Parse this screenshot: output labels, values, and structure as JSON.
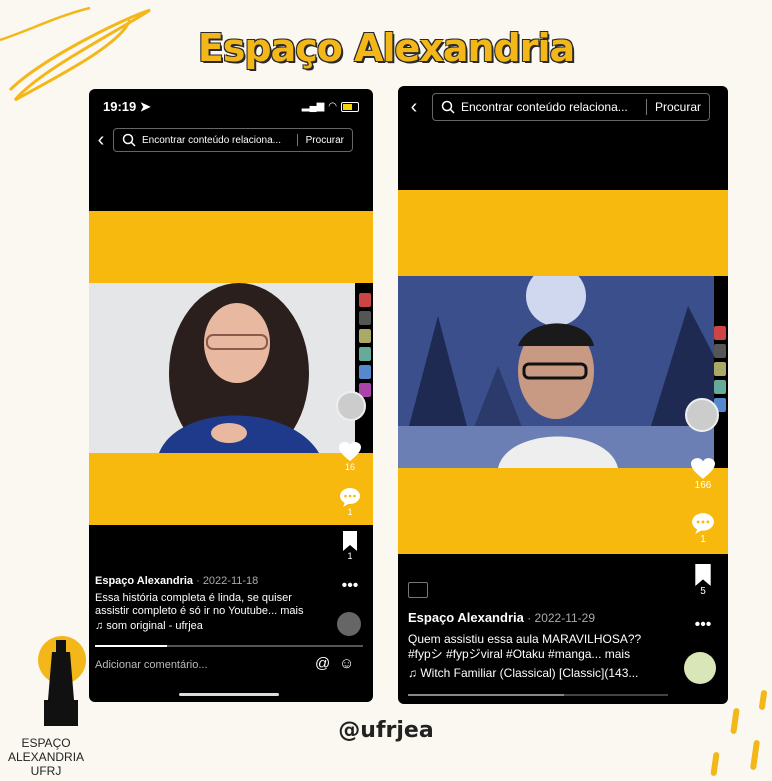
{
  "header": {
    "title": "Espaço Alexandria"
  },
  "footer": {
    "handle": "@ufrjea",
    "logo_lines": [
      "ESPAÇO",
      "ALEXANDRIA",
      "UFRJ"
    ]
  },
  "left_phone": {
    "status_time": "19:19",
    "search_placeholder": "Encontrar conteúdo relaciona...",
    "search_button": "Procurar",
    "like_count": "16",
    "comment_count": "1",
    "bookmark_count": "1",
    "author": "Espaço Alexandria",
    "date": "· 2022-11-18",
    "caption_line1": "Essa história completa é linda, se quiser",
    "caption_line2": "assistir completo é só ir no Youtube... mais",
    "sound": "♫ som original - ufrjea",
    "comment_placeholder": "Adicionar comentário...",
    "progress_fraction": 0.27
  },
  "right_phone": {
    "search_placeholder": "Encontrar conteúdo relaciona...",
    "search_button": "Procurar",
    "like_count": "166",
    "comment_count": "1",
    "bookmark_count": "5",
    "author": "Espaço Alexandria",
    "date": "· 2022-11-29",
    "caption_line1": "Quem assistiu essa aula MARAVILHOSA??",
    "caption_line2": "#fypシ #fypジviral #Otaku #manga... mais",
    "sound": "♫ Witch Familiar (Classical) [Classic](143...",
    "progress_fraction": 0.6
  },
  "colors": {
    "accent": "#f8b90e",
    "background": "#fbf8f1"
  }
}
